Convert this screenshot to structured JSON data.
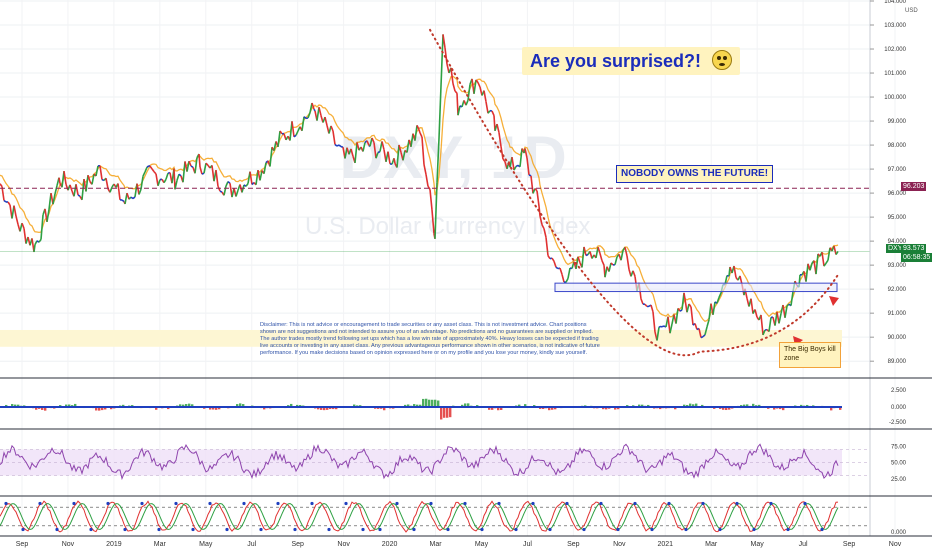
{
  "chart_data": {
    "type": "line",
    "watermark": "DXY, 1D",
    "watermark_sub": "U.S. Dollar Currency Index",
    "currency_label": "USD",
    "main": {
      "ylim": [
        88.3,
        104.0
      ],
      "yticks": [
        "104.000",
        "103.000",
        "102.000",
        "101.000",
        "100.000",
        "99.000",
        "98.000",
        "97.000",
        "96.000",
        "95.000",
        "94.000",
        "93.000",
        "92.000",
        "91.000",
        "90.000",
        "89.000"
      ],
      "xlabels": [
        "Sep",
        "Nov",
        "2019",
        "Mar",
        "May",
        "Jul",
        "Sep",
        "Nov",
        "2020",
        "Mar",
        "May",
        "Jul",
        "Sep",
        "Nov",
        "2021",
        "Mar",
        "May",
        "Jul",
        "Sep",
        "Nov"
      ],
      "series": [
        {
          "anchors": [
            [
              0,
              96.4
            ],
            [
              20,
              94.6
            ],
            [
              35,
              93.8
            ],
            [
              60,
              96.6
            ],
            [
              80,
              96.0
            ],
            [
              100,
              97.0
            ],
            [
              125,
              95.6
            ],
            [
              150,
              96.8
            ],
            [
              175,
              96.6
            ],
            [
              200,
              97.3
            ],
            [
              230,
              96.1
            ],
            [
              260,
              96.9
            ],
            [
              280,
              98.2
            ],
            [
              315,
              99.5
            ],
            [
              345,
              97.4
            ],
            [
              370,
              98.0
            ],
            [
              395,
              97.4
            ],
            [
              420,
              98.6
            ],
            [
              435,
              94.4
            ],
            [
              443,
              102.6
            ],
            [
              458,
              99.6
            ],
            [
              478,
              100.8
            ],
            [
              495,
              98.7
            ],
            [
              510,
              97.0
            ],
            [
              525,
              97.6
            ],
            [
              540,
              95.2
            ],
            [
              552,
              93.0
            ],
            [
              570,
              92.5
            ],
            [
              590,
              93.8
            ],
            [
              605,
              92.9
            ],
            [
              625,
              93.6
            ],
            [
              660,
              90.0
            ],
            [
              685,
              91.5
            ],
            [
              705,
              90.1
            ],
            [
              715,
              91.6
            ],
            [
              730,
              93.0
            ],
            [
              745,
              91.8
            ],
            [
              765,
              90.3
            ],
            [
              785,
              91.2
            ],
            [
              800,
              92.6
            ],
            [
              820,
              93.1
            ],
            [
              838,
              93.57
            ]
          ],
          "colors": {
            "up": "#2ea043",
            "down": "#e03131",
            "neutral": "#1f3fbf",
            "band": "#f5a623"
          }
        }
      ],
      "last_price": {
        "label": "DXY",
        "value": "93.573",
        "countdown": "06:58:35"
      },
      "resistance": {
        "value": "96.203"
      },
      "support_box": [
        91.9,
        92.25
      ],
      "highlight_band": [
        89.6,
        90.3
      ],
      "dotted_curve": {
        "from": [
          430,
          102.8
        ],
        "bottom": [
          700,
          89.4
        ],
        "to": [
          838,
          92.6
        ]
      }
    },
    "macd": {
      "yticks": [
        "2.500",
        "0.000",
        "-2.500"
      ]
    },
    "rsi": {
      "yticks": [
        "75.00",
        "50.00",
        "25.00"
      ],
      "band": [
        30,
        70
      ]
    },
    "stoch": {
      "yticks": [
        "0.000"
      ]
    }
  },
  "annotations": {
    "surprised": "Are you surprised?! ",
    "future": "NOBODY OWNS THE FUTURE!",
    "zone": "The Big Boys kill zone",
    "disclaimer": "Disclaimer: This is not advice or encouragement to trade securities or any asset class. This is not investment advice. Chart positions shown are not suggestions and not intended to assure you of an advantage. No predictions and no guarantees are supplied or implied. The author trades mostly trend following set ups which has a low win rate of approximately 40%. Heavy losses can be expected if trading live accounts or investing in any asset class. Any previous advantageous performance shown in other scenarios, is not indicative of future performance. If you make decisions based on opinion expressed here or on my profile and you lose your money, kindly sue yourself."
  },
  "colors": {
    "accent": "#1b2dbb",
    "resistance": "#8b2252",
    "price_tag": "#1a7f37"
  }
}
